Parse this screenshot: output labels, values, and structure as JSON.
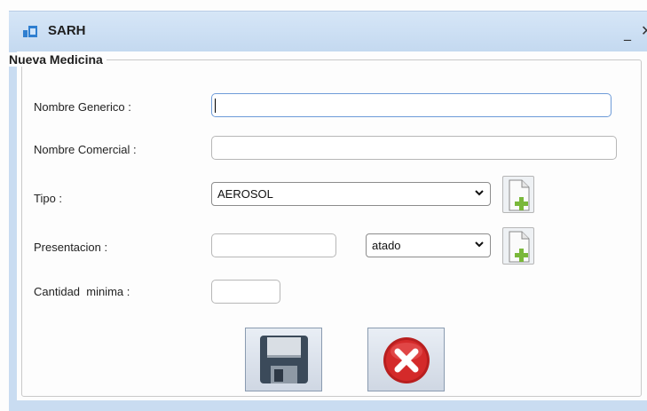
{
  "window": {
    "title": "SARH",
    "minimize_glyph": "_",
    "close_glyph": "✕",
    "app_icon": "window-app-icon"
  },
  "form": {
    "legend": "Nueva Medicina",
    "nombre_generico": {
      "label": "Nombre Generico :",
      "value": ""
    },
    "nombre_comercial": {
      "label": "Nombre Comercial :",
      "value": ""
    },
    "tipo": {
      "label": "Tipo :",
      "selected": "AEROSOL",
      "add_icon": "add-document-icon"
    },
    "presentacion": {
      "label": "Presentacion :",
      "value": "",
      "selected": "atado",
      "add_icon": "add-document-icon"
    },
    "cantidad_minima": {
      "label": "Cantidad  minima :",
      "value": ""
    }
  },
  "actions": {
    "save_icon": "floppy-disk-icon",
    "cancel_icon": "red-x-circle-icon"
  },
  "colors": {
    "titlebar": "#c4d9f0",
    "accent_green": "#7ab83a",
    "cancel_red": "#d42a2a"
  }
}
